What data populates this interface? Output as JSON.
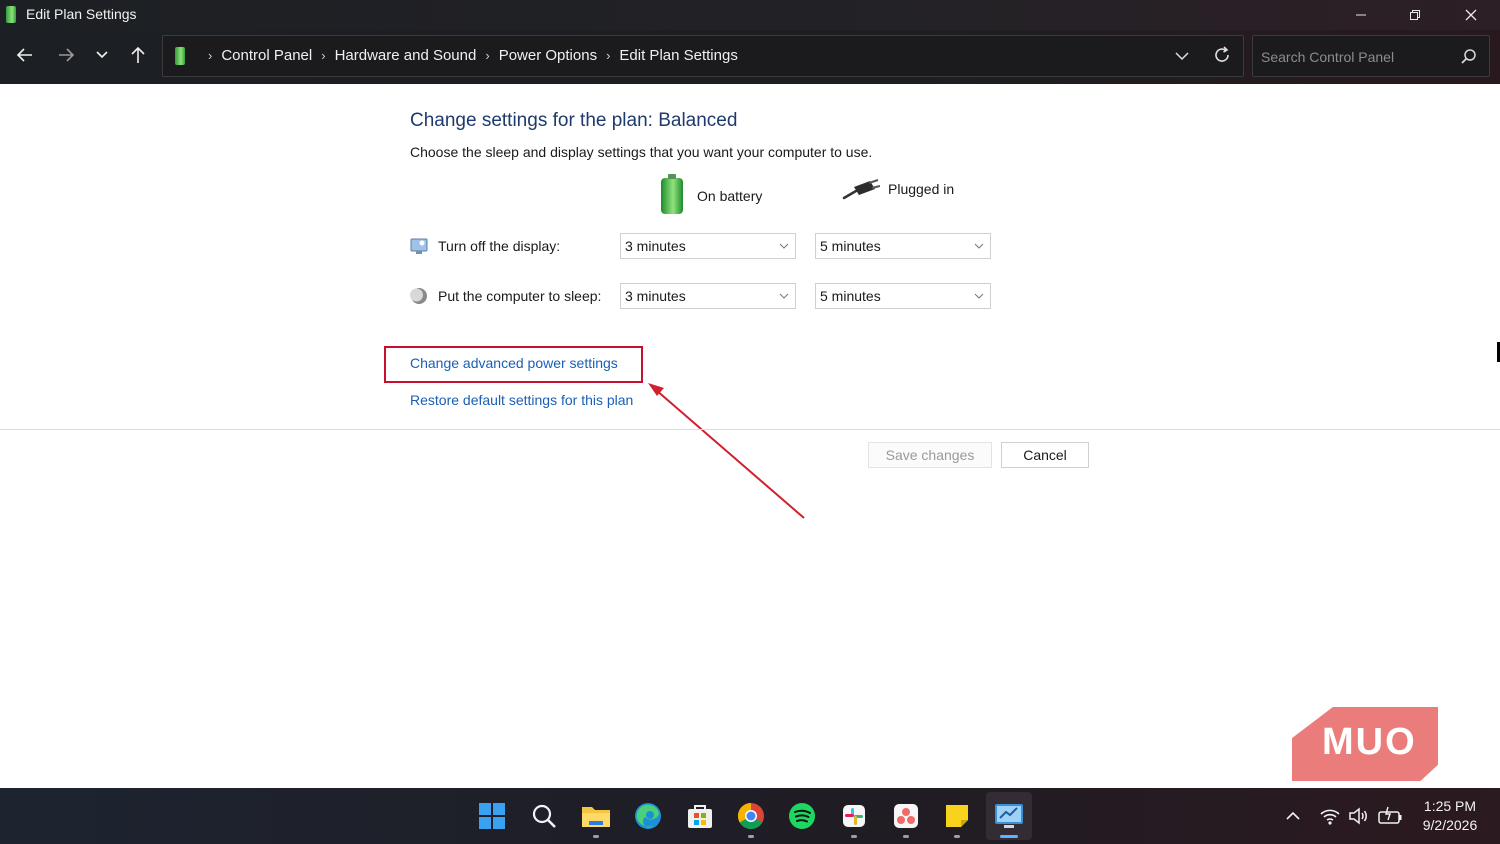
{
  "window": {
    "title": "Edit Plan Settings",
    "controls": {
      "minimize_icon": "minimize-icon",
      "restore_icon": "restore-icon",
      "close_icon": "close-icon"
    }
  },
  "navigation": {
    "buttons": [
      "back-arrow-icon",
      "forward-arrow-icon",
      "recent-locations-chevron-icon",
      "up-arrow-icon"
    ],
    "breadcrumbs": [
      "Control Panel",
      "Hardware and Sound",
      "Power Options",
      "Edit Plan Settings"
    ],
    "search": {
      "placeholder": "Search Control Panel",
      "value": ""
    }
  },
  "main": {
    "heading": "Change settings for the plan: Balanced",
    "subtitle": "Choose the sleep and display settings that you want your computer to use.",
    "columns": {
      "battery": "On battery",
      "plugged": "Plugged in"
    },
    "settings": [
      {
        "label": "Turn off the display:",
        "battery": "3 minutes",
        "plugged": "5 minutes"
      },
      {
        "label": "Put the computer to sleep:",
        "battery": "3 minutes",
        "plugged": "5 minutes"
      }
    ],
    "links": {
      "advanced": "Change advanced power settings",
      "restore": "Restore default settings for this plan"
    },
    "buttons": {
      "save": "Save changes",
      "cancel": "Cancel"
    },
    "annotation_color": "#c8102e"
  },
  "watermark": {
    "text": "MUO",
    "color": "#ea7c7c"
  },
  "taskbar": {
    "apps": [
      "windows-start-icon",
      "search-icon",
      "file-explorer-icon",
      "edge-browser-icon",
      "microsoft-store-icon",
      "chrome-icon",
      "spotify-icon",
      "slack-icon",
      "asana-icon",
      "sticky-notes-icon",
      "control-panel-icon"
    ],
    "tray": [
      "show-hidden-icons-chevron-icon",
      "wifi-icon",
      "volume-icon",
      "battery-icon"
    ],
    "time": "1:25 PM",
    "date": "9/2/2026"
  }
}
